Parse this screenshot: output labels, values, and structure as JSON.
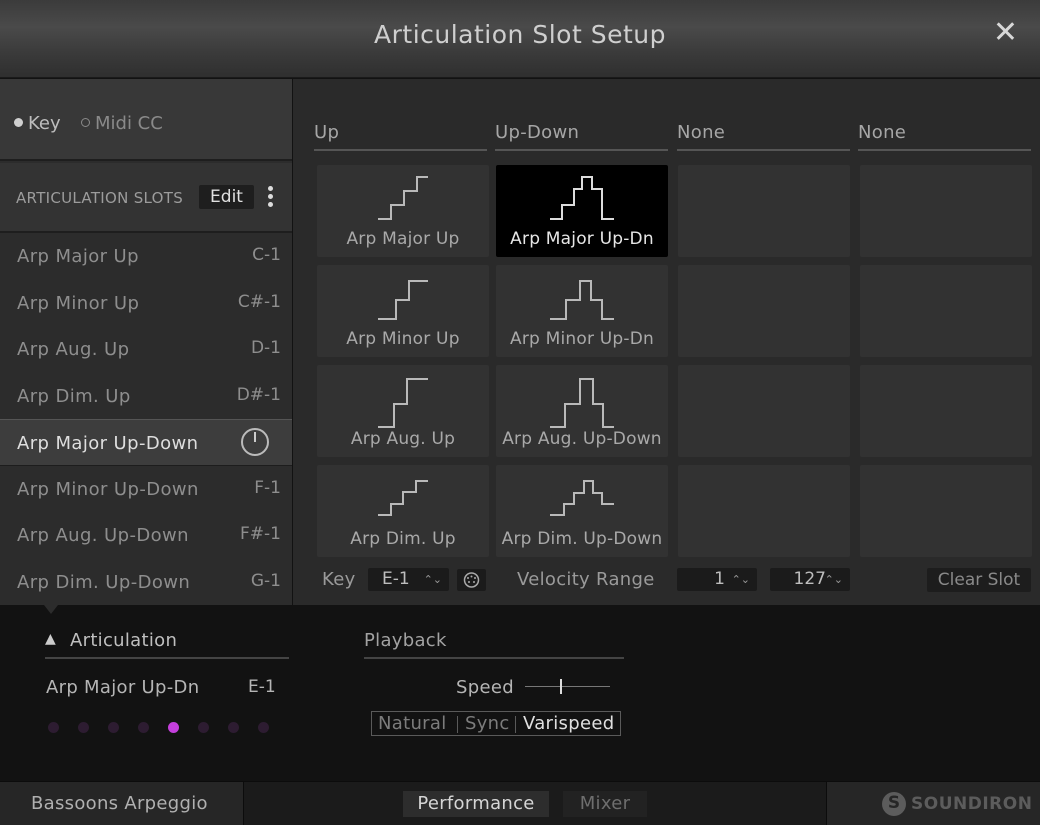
{
  "window": {
    "title": "Articulation Slot Setup",
    "close_glyph": "✕"
  },
  "trigger_mode": {
    "options": [
      "Key",
      "Midi CC"
    ],
    "selected": "Key"
  },
  "slots_panel": {
    "label": "ARTICULATION SLOTS",
    "edit_label": "Edit",
    "slots": [
      {
        "name": "Arp Major Up",
        "key": "C-1"
      },
      {
        "name": "Arp Minor Up",
        "key": "C#-1"
      },
      {
        "name": "Arp Aug. Up",
        "key": "D-1"
      },
      {
        "name": "Arp Dim. Up",
        "key": "D#-1"
      },
      {
        "name": "Arp Major Up-Down",
        "key": "",
        "active": true
      },
      {
        "name": "Arp Minor Up-Down",
        "key": "F-1"
      },
      {
        "name": "Arp Aug. Up-Down",
        "key": "F#-1"
      },
      {
        "name": "Arp Dim. Up-Down",
        "key": "G-1"
      }
    ]
  },
  "grid": {
    "columns": [
      "Up",
      "Up-Down",
      "None",
      "None"
    ],
    "rows": [
      [
        "Arp Major Up",
        "Arp Major Up-Dn",
        "",
        ""
      ],
      [
        "Arp Minor Up",
        "Arp Minor Up-Dn",
        "",
        ""
      ],
      [
        "Arp Aug. Up",
        "Arp Aug. Up-Down",
        "",
        ""
      ],
      [
        "Arp Dim. Up",
        "Arp Dim. Up-Down",
        "",
        ""
      ]
    ],
    "selected_cell": "Arp Major Up-Dn"
  },
  "controls": {
    "key_label": "Key",
    "key_value": "E-1",
    "velocity_label": "Velocity Range",
    "velocity_min": "1",
    "velocity_max": "127",
    "clear_label": "Clear Slot"
  },
  "articulation": {
    "header": "Articulation",
    "current_name": "Arp Major Up-Dn",
    "current_key": "E-1",
    "dots_total": 8,
    "dot_active_index": 4,
    "accent_color": "#c43fdc"
  },
  "playback": {
    "header": "Playback",
    "speed_label": "Speed",
    "speed_value": 0.42,
    "modes": [
      "Natural",
      "Sync",
      "Varispeed"
    ],
    "selected_mode": "Varispeed"
  },
  "footer": {
    "instrument": "Bassoons Arpeggio",
    "tabs": [
      "Performance",
      "Mixer"
    ],
    "selected_tab": "Performance",
    "logo": "SOUNDIRON"
  }
}
